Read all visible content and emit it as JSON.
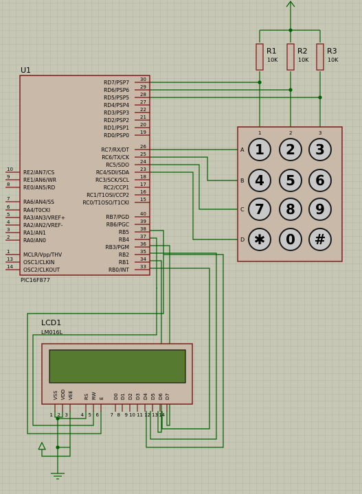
{
  "mcu": {
    "ref": "U1",
    "part": "PIC16F877",
    "left_pins": [
      {
        "num": "10",
        "name": "RE2/AN7/CS"
      },
      {
        "num": "9",
        "name": "RE1/AN6/WR"
      },
      {
        "num": "8",
        "name": "RE0/AN5/RD"
      },
      {
        "num": "7",
        "name": "RA6/AN4/SS"
      },
      {
        "num": "6",
        "name": "RA4/T0CKI"
      },
      {
        "num": "5",
        "name": "RA3/AN3/VREF+"
      },
      {
        "num": "4",
        "name": "RA2/AN2/VREF-"
      },
      {
        "num": "3",
        "name": "RA1/AN1"
      },
      {
        "num": "2",
        "name": "RA0/AN0"
      },
      {
        "num": "1",
        "name": "MCLR/Vpp/THV"
      },
      {
        "num": "13",
        "name": "OSC1/CLKIN"
      },
      {
        "num": "14",
        "name": "OSC2/CLKOUT"
      }
    ],
    "right_pins": [
      {
        "num": "30",
        "name": "RD7/PSP7"
      },
      {
        "num": "29",
        "name": "RD6/PSP6"
      },
      {
        "num": "28",
        "name": "RD5/PSP5"
      },
      {
        "num": "27",
        "name": "RD4/PSP4"
      },
      {
        "num": "22",
        "name": "RD3/PSP3"
      },
      {
        "num": "21",
        "name": "RD2/PSP2"
      },
      {
        "num": "20",
        "name": "RD1/PSP1"
      },
      {
        "num": "19",
        "name": "RD0/PSP0"
      },
      {
        "num": "26",
        "name": "RC7/RX/DT"
      },
      {
        "num": "25",
        "name": "RC6/TX/CK"
      },
      {
        "num": "24",
        "name": "RC5/SDO"
      },
      {
        "num": "23",
        "name": "RC4/SDI/SDA"
      },
      {
        "num": "18",
        "name": "RC3/SCK/SCL"
      },
      {
        "num": "17",
        "name": "RC2/CCP1"
      },
      {
        "num": "16",
        "name": "RC1/T1OSI/CCP2"
      },
      {
        "num": "15",
        "name": "RC0/T1OSO/T1CKI"
      },
      {
        "num": "40",
        "name": "RB7/PGD"
      },
      {
        "num": "39",
        "name": "RB6/PGC"
      },
      {
        "num": "38",
        "name": "RB5"
      },
      {
        "num": "37",
        "name": "RB4"
      },
      {
        "num": "36",
        "name": "RB3/PGM"
      },
      {
        "num": "35",
        "name": "RB2"
      },
      {
        "num": "34",
        "name": "RB1"
      },
      {
        "num": "33",
        "name": "RB0/INT"
      }
    ]
  },
  "resistors": [
    {
      "ref": "R1",
      "value": "10K"
    },
    {
      "ref": "R2",
      "value": "10K"
    },
    {
      "ref": "R3",
      "value": "10K"
    }
  ],
  "keypad": {
    "col_labels": [
      "1",
      "2",
      "3"
    ],
    "row_labels": [
      "A",
      "B",
      "C",
      "D"
    ],
    "keys": [
      "1",
      "2",
      "3",
      "4",
      "5",
      "6",
      "7",
      "8",
      "9",
      "✱",
      "0",
      "#"
    ]
  },
  "lcd": {
    "ref": "LCD1",
    "part": "LM016L",
    "pins": [
      {
        "num": "1",
        "name": "VSS"
      },
      {
        "num": "2",
        "name": "VDD"
      },
      {
        "num": "3",
        "name": "VEE"
      },
      {
        "num": "4",
        "name": "RS"
      },
      {
        "num": "5",
        "name": "RW"
      },
      {
        "num": "6",
        "name": "E"
      },
      {
        "num": "7",
        "name": "D0"
      },
      {
        "num": "8",
        "name": "D1"
      },
      {
        "num": "9",
        "name": "D2"
      },
      {
        "num": "10",
        "name": "D3"
      },
      {
        "num": "11",
        "name": "D4"
      },
      {
        "num": "12",
        "name": "D5"
      },
      {
        "num": "13",
        "name": "D6"
      },
      {
        "num": "14",
        "name": "D7"
      }
    ]
  },
  "colors": {
    "background": "#c7c7b6",
    "grid": "#b3b3a2",
    "wire": "#006000",
    "component_outline": "#7a1010",
    "component_fill": "#c9b9a9",
    "key_fill": "#c8c8c8",
    "lcd_screen": "#557a30"
  }
}
